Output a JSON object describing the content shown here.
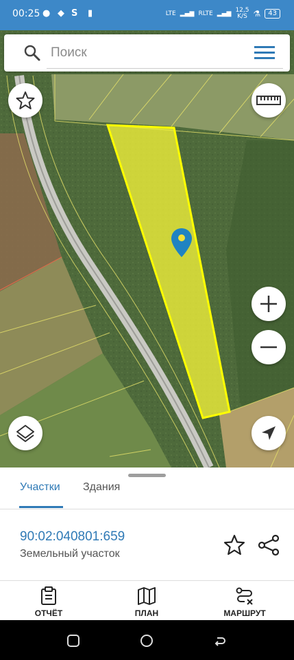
{
  "status": {
    "time": "00:25",
    "signal1": "LTE",
    "signal2": "RLTE",
    "speed_top": "12,5",
    "speed_bottom": "K/S",
    "battery": "43"
  },
  "search": {
    "placeholder": "Поиск"
  },
  "icons": {
    "search": "search-icon",
    "menu": "menu-icon",
    "favorite": "star-icon",
    "ruler": "ruler-icon",
    "zoom_in": "plus-icon",
    "zoom_out": "minus-icon",
    "layers": "layers-icon",
    "locate": "navigation-arrow-icon",
    "pin": "map-pin-icon"
  },
  "tabs": [
    {
      "label": "Участки",
      "active": true
    },
    {
      "label": "Здания",
      "active": false
    }
  ],
  "parcel": {
    "cadastral_number": "90:02:040801:659",
    "type": "Земельный участок"
  },
  "bottom_nav": [
    {
      "label": "ОТЧЁТ"
    },
    {
      "label": "ПЛАН"
    },
    {
      "label": "МАРШРУТ"
    }
  ],
  "colors": {
    "accent": "#2f7ab6",
    "status_bar": "#3d88c8",
    "parcel_fill": "#f2f23a",
    "parcel_border": "#ffff00"
  }
}
